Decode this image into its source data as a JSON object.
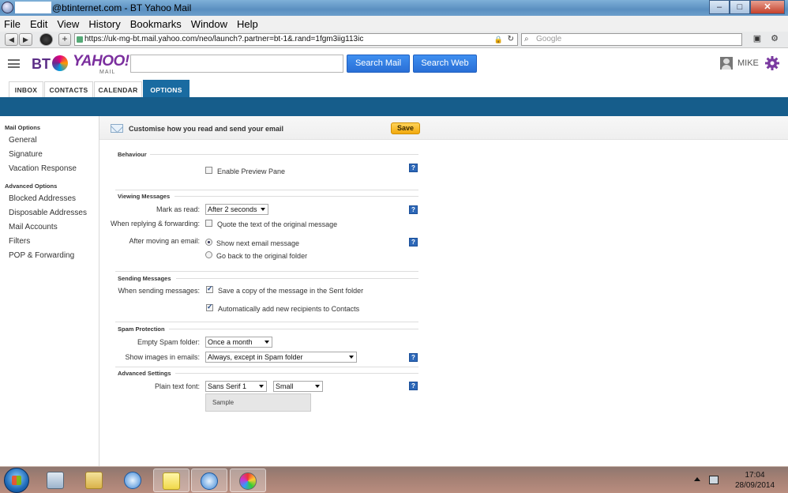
{
  "window": {
    "title": "@btinternet.com - BT Yahoo Mail",
    "buttons": {
      "minimize": "–",
      "maximize": "□",
      "close": "✕"
    }
  },
  "menu": [
    "File",
    "Edit",
    "View",
    "History",
    "Bookmarks",
    "Window",
    "Help"
  ],
  "nav": {
    "back": "◀",
    "forward": "▶",
    "url": "https://uk-mg-bt.mail.yahoo.com/neo/launch?.partner=bt-1&.rand=1fgm3iig113ic",
    "search_placeholder": "Google"
  },
  "header": {
    "logo_bt": "BT",
    "logo_yahoo": "YAHOO!",
    "logo_mail": "MAIL",
    "search_mail": "Search Mail",
    "search_web": "Search Web",
    "user_name": "MIKE"
  },
  "tabs": [
    "INBOX",
    "CONTACTS",
    "CALENDAR",
    "OPTIONS"
  ],
  "sidebar": {
    "mail_options_heading": "Mail Options",
    "mail_options": [
      "General",
      "Signature",
      "Vacation Response"
    ],
    "advanced_heading": "Advanced Options",
    "advanced": [
      "Blocked Addresses",
      "Disposable Addresses",
      "Mail Accounts",
      "Filters",
      "POP & Forwarding"
    ]
  },
  "main": {
    "title": "Customise how you read and send your email",
    "save": "Save",
    "behaviour": {
      "heading": "Behaviour",
      "preview_pane": "Enable Preview Pane",
      "preview_pane_checked": false
    },
    "viewing": {
      "heading": "Viewing Messages",
      "mark_as_read_label": "Mark as read:",
      "mark_as_read_value": "After 2 seconds",
      "replying_label": "When replying & forwarding:",
      "quote_text": "Quote the text of the original message",
      "quote_checked": false,
      "after_moving_label": "After moving an email:",
      "show_next": "Show next email message",
      "go_back": "Go back to the original folder",
      "after_moving_selected": "show_next"
    },
    "sending": {
      "heading": "Sending Messages",
      "when_sending_label": "When sending messages:",
      "save_copy": "Save a copy of the message in the Sent folder",
      "save_copy_checked": true,
      "auto_add": "Automatically add new recipients to Contacts",
      "auto_add_checked": true
    },
    "spam": {
      "heading": "Spam Protection",
      "empty_label": "Empty Spam folder:",
      "empty_value": "Once a month",
      "images_label": "Show images in emails:",
      "images_value": "Always, except in Spam folder"
    },
    "advanced": {
      "heading": "Advanced Settings",
      "font_label": "Plain text font:",
      "font_family": "Sans Serif 1",
      "font_size": "Small",
      "sample": "Sample"
    },
    "help_glyph": "?"
  },
  "taskbar": {
    "time": "17:04",
    "date": "28/09/2014"
  },
  "colors": {
    "brand_blue": "#196ba1",
    "band": "#165d8b",
    "save_yellow": "#f2a90c",
    "search_blue": "#2a6fd6"
  }
}
